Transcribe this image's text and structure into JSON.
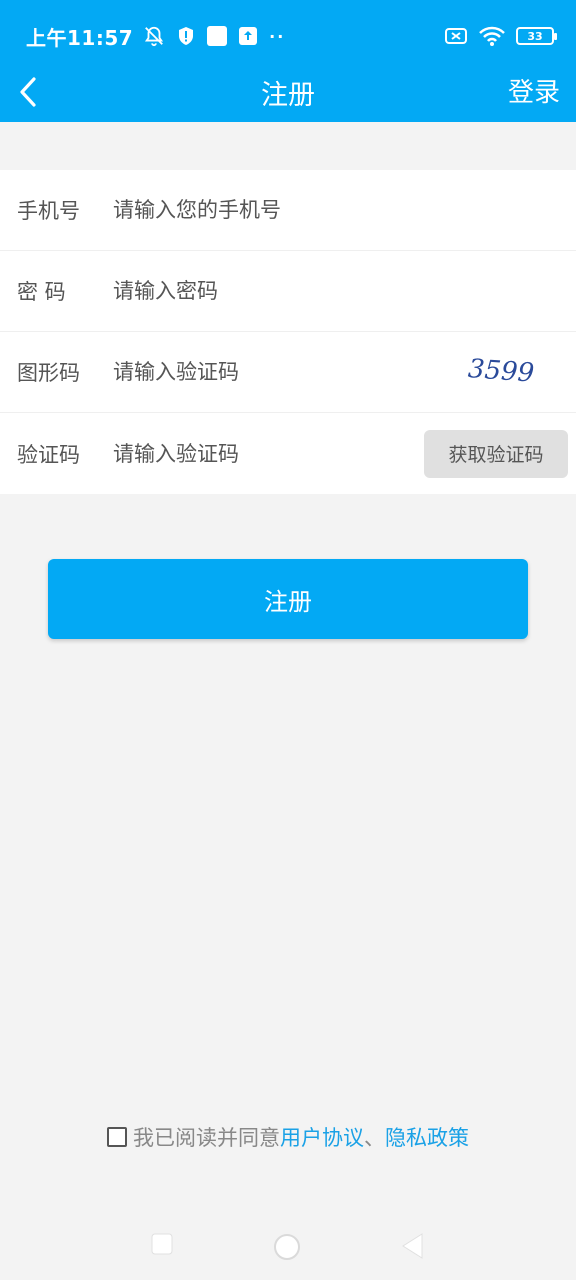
{
  "status_bar": {
    "time": "上午11:57",
    "battery": "33"
  },
  "app_bar": {
    "title": "注册",
    "login_label": "登录"
  },
  "form": {
    "phone": {
      "label": "手机号",
      "placeholder": "请输入您的手机号"
    },
    "password": {
      "label": "密 码",
      "placeholder": "请输入密码"
    },
    "captcha": {
      "label": "图形码",
      "placeholder": "请输入验证码",
      "image_text": "3599"
    },
    "sms_code": {
      "label": "验证码",
      "placeholder": "请输入验证码",
      "button_label": "获取验证码"
    }
  },
  "register_button": "注册",
  "agreement": {
    "prefix": "我已阅读并同意",
    "user_agreement": "用户协议",
    "separator": "、",
    "privacy_policy": "隐私政策"
  },
  "colors": {
    "primary": "#03a9f4",
    "link": "#1aa1e6",
    "background": "#f3f3f3"
  }
}
